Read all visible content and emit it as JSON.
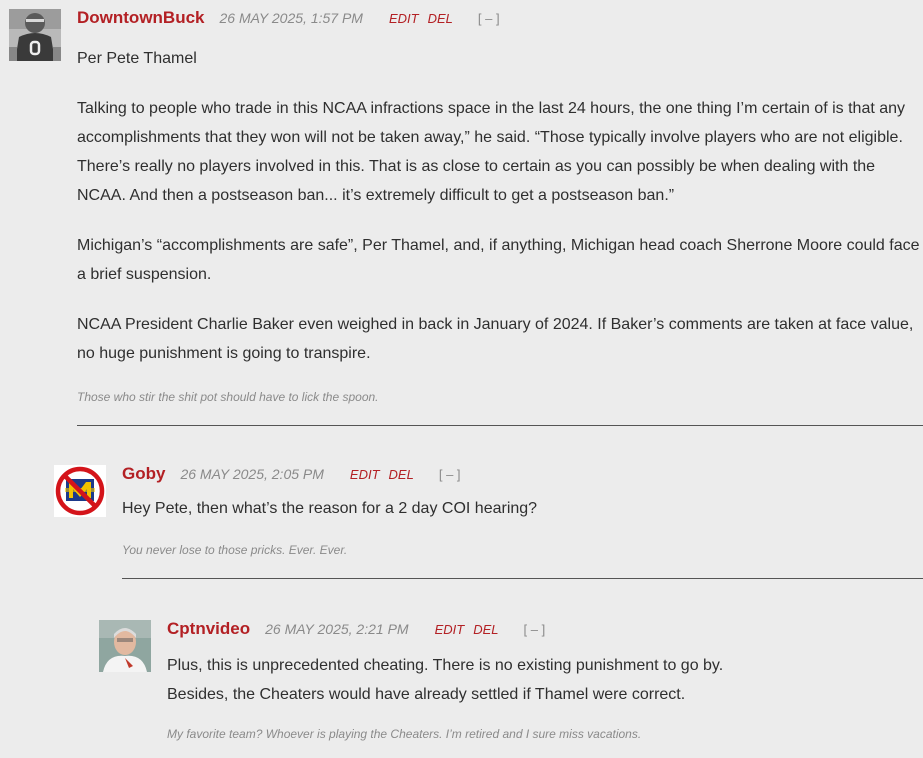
{
  "actions": {
    "edit": "EDIT",
    "del": "DEL",
    "collapse": "[ – ]"
  },
  "comments": [
    {
      "author": "DowntownBuck",
      "date": "26 MAY 2025, 1:57 PM",
      "paragraphs": [
        "Per Pete Thamel",
        "Talking to people who trade in this NCAA infractions space in the last 24 hours, the one thing I’m certain of is that any accomplishments that they won will not be taken away,” he said. “Those typically involve players who are not eligible. There’s really no players involved in this. That is as close to certain as you can possibly be when dealing with the NCAA. And then a postseason ban... it’s extremely difficult to get a postseason ban.”",
        "Michigan’s “accomplishments are safe”, Per Thamel, and, if anything, Michigan head coach Sherrone Moore could face a brief suspension.",
        "NCAA President Charlie Baker even weighed in back in January of 2024. If Baker’s comments are taken at face value, no huge punishment is going to transpire."
      ],
      "signature": "Those who stir the shit pot should have to lick the spoon."
    },
    {
      "author": "Goby",
      "date": "26 MAY 2025, 2:05 PM",
      "paragraphs": [
        "Hey Pete, then what’s the reason for a 2 day COI hearing?"
      ],
      "signature": "You never lose to those pricks. Ever. Ever."
    },
    {
      "author": "Cptnvideo",
      "date": "26 MAY 2025, 2:21 PM",
      "paragraphs": [
        "Plus, this is unprecedented cheating. There is no existing punishment to go by.",
        "Besides, the Cheaters would have already settled if Thamel were correct."
      ],
      "signature": "My favorite team? Whoever is playing the Cheaters. I’m retired and I sure miss vacations."
    }
  ]
}
